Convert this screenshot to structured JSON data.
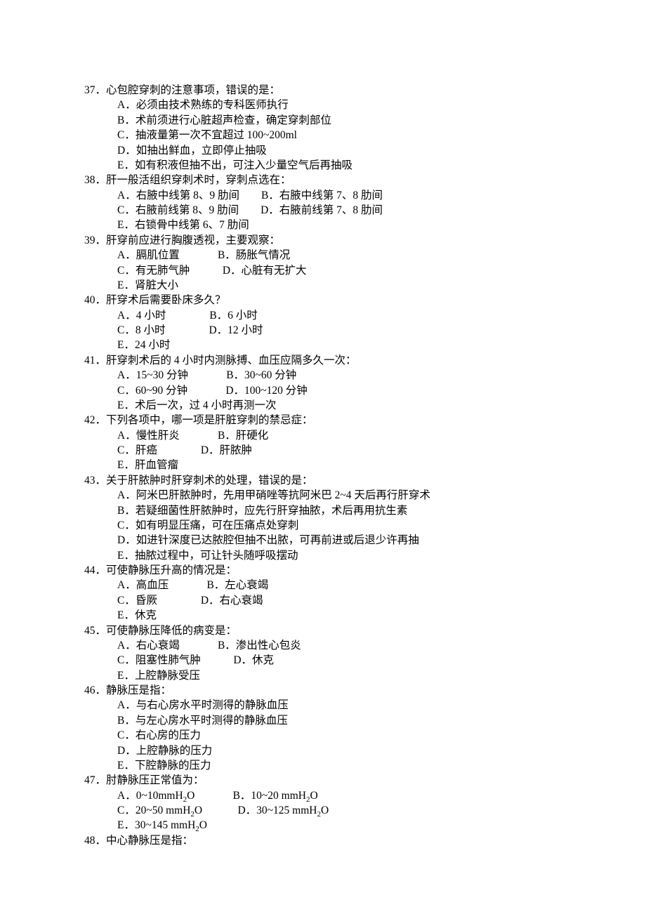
{
  "questions": [
    {
      "num": "37．",
      "stem": "心包腔穿刺的注意事项，错误的是：",
      "rows": [
        "A．必须由技术熟练的专科医师执行",
        "B．术前须进行心脏超声检查，确定穿刺部位",
        "C．抽液量第一次不宜超过 100~200ml",
        "D．如抽出鲜血，立即停止抽吸",
        "E．如有积液但抽不出，可注入少量空气后再抽吸"
      ]
    },
    {
      "num": "38．",
      "stem": "肝一般活组织穿刺术时，穿刺点选在：",
      "rows": [
        "A．右腋中线第 8、9 肋间        B．右腋中线第 7、8 肋间",
        "C．右腋前线第 8、9 肋间        D．右腋前线第 7、8 肋间",
        "E．右锁骨中线第 6、7 肋间"
      ]
    },
    {
      "num": "39．",
      "stem": "肝穿前应进行胸腹透视，主要观察：",
      "rows": [
        "A．膈肌位置              B．肠胀气情况",
        "C．有无肺气肿            D．心脏有无扩大",
        "E．肾脏大小"
      ]
    },
    {
      "num": "40．",
      "stem": "肝穿术后需要卧床多久？",
      "rows": [
        "A．4 小时                B．6 小时",
        "C．8 小时                D．12 小时",
        "E．24 小时"
      ]
    },
    {
      "num": "41．",
      "stem": "肝穿刺术后的 4 小时内测脉搏、血压应隔多久一次：",
      "rows": [
        "A．15~30 分钟              B．30~60 分钟",
        "C．60~90 分钟              D．100~120 分钟",
        "E．术后一次，过 4 小时再测一次"
      ]
    },
    {
      "num": "42．",
      "stem": "下列各项中，哪一项是肝脏穿刺的禁忌症：",
      "rows": [
        "A．慢性肝炎              B．肝硬化",
        "C．肝癌                D．肝脓肿",
        "E．肝血管瘤"
      ]
    },
    {
      "num": "43．",
      "stem": "关于肝脓肿时肝穿刺术的处理，错误的是：",
      "rows": [
        "A．阿米巴肝脓肿时，先用甲硝唑等抗阿米巴 2~4 天后再行肝穿术",
        "B．若疑细菌性肝脓肿时，应先行肝穿抽脓，术后再用抗生素",
        "C．如有明显压痛，可在压痛点处穿刺",
        "D．如进针深度已达脓腔但抽不出脓，可再前进或后退少许再抽",
        "E．抽脓过程中，可让针头随呼吸摆动"
      ]
    },
    {
      "num": "44．",
      "stem": "可使静脉压升高的情况是：",
      "rows": [
        "A．高血压              B．左心衰竭",
        "C．昏厥                D．右心衰竭",
        "E．休克"
      ]
    },
    {
      "num": "45．",
      "stem": "可使静脉压降低的病变是：",
      "rows": [
        "A．右心衰竭              B．渗出性心包炎",
        "C．阻塞性肺气肿            D．休克",
        "E．上腔静脉受压"
      ]
    },
    {
      "num": "46．",
      "stem": "静脉压是指：",
      "rows": [
        "A．与右心房水平时测得的静脉血压",
        "B．与左心房水平时测得的静脉血压",
        "C．右心房的压力",
        "D．上腔静脉的压力",
        "E．下腔静脉的压力"
      ]
    },
    {
      "num": "47．",
      "stem": "肘静脉压正常值为：",
      "rows": [
        "A．0~10mmH{sub2}O              B．10~20 mmH{sub2}O",
        "C．20~50 mmH{sub2}O             D．30~125 mmH{sub2}O",
        "E．30~145 mmH{sub2}O"
      ]
    },
    {
      "num": "48．",
      "stem": "中心静脉压是指：",
      "rows": []
    }
  ]
}
